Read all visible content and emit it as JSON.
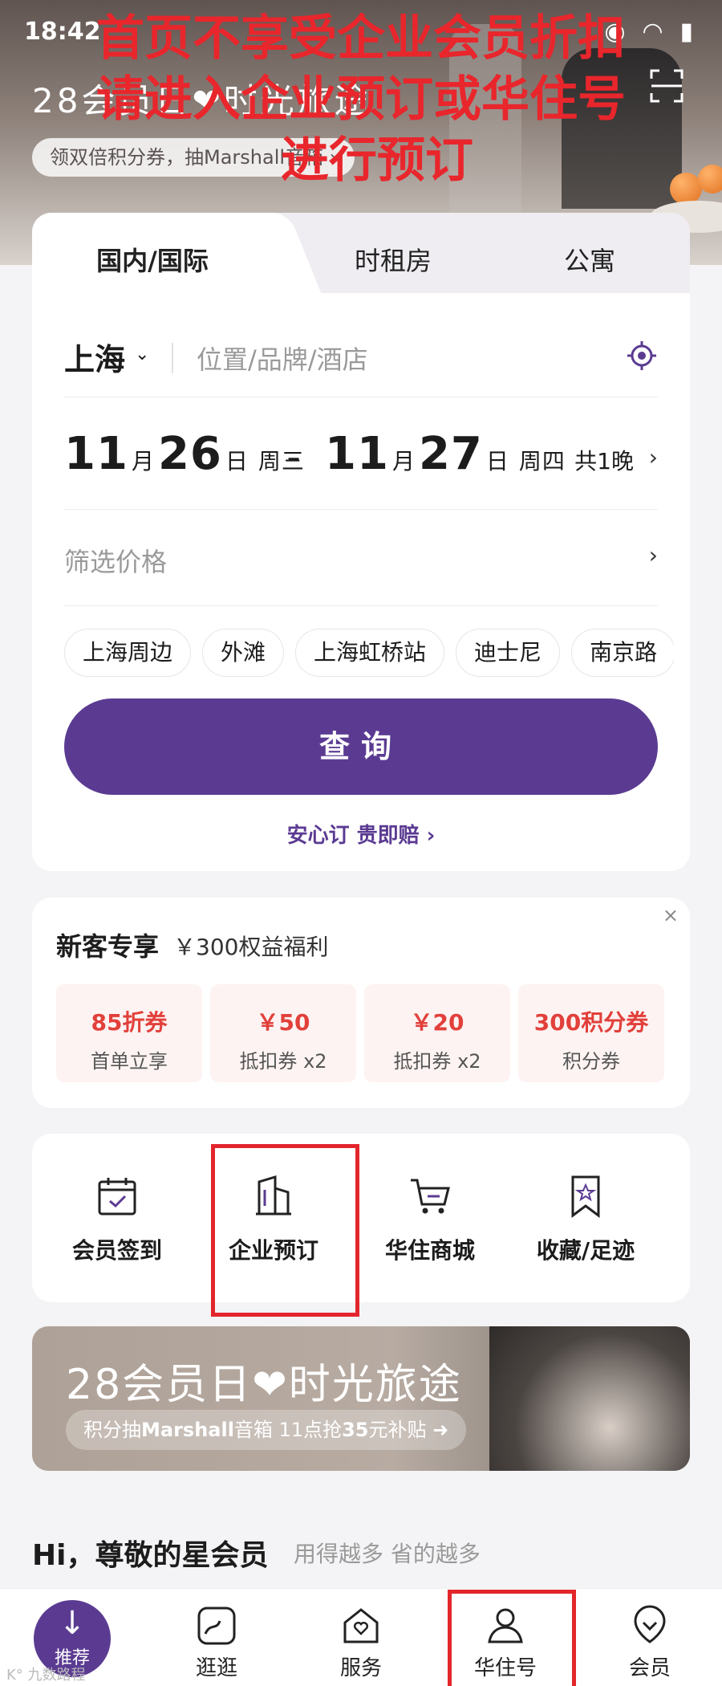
{
  "status": {
    "time": "18:42",
    "icons": "◉ ◠ ▮"
  },
  "hero": {
    "title": "28会员日❤时光旅途",
    "pill": "领双倍积分券，抽Marshall音箱 ›"
  },
  "annotation": {
    "line1": "首页不享受企业会员折扣",
    "line2": "请进入企业预订或华住号",
    "line3": "进行预订"
  },
  "booking": {
    "tabs": [
      "国内/国际",
      "时租房",
      "公寓"
    ],
    "city": "上海",
    "search_placeholder": "位置/品牌/酒店",
    "checkin": {
      "month": "11",
      "day": "26",
      "weekday": "周三"
    },
    "checkout": {
      "month": "11",
      "day": "27",
      "weekday": "周四"
    },
    "month_unit": "月",
    "day_unit": "日",
    "nights": "共1晚",
    "price_placeholder": "筛选价格",
    "chips": [
      "上海周边",
      "外滩",
      "上海虹桥站",
      "迪士尼",
      "南京路"
    ],
    "query_label": "查询",
    "assurance": "安心订 贵即赔 ›"
  },
  "new_customer": {
    "title": "新客专享",
    "subtitle": "￥300权益福利",
    "coupons": [
      {
        "value": "85折券",
        "desc": "首单立享"
      },
      {
        "value": "￥50",
        "desc": "抵扣券 x2"
      },
      {
        "value": "￥20",
        "desc": "抵扣券 x2"
      },
      {
        "value": "300积分券",
        "desc": "积分券"
      }
    ]
  },
  "quick_actions": [
    {
      "label": "会员签到",
      "icon": "calendar-check-icon"
    },
    {
      "label": "企业预订",
      "icon": "building-icon"
    },
    {
      "label": "华住商城",
      "icon": "cart-icon"
    },
    {
      "label": "收藏/足迹",
      "icon": "bookmark-star-icon"
    }
  ],
  "banner": {
    "title": "28会员日❤时光旅途",
    "sub_prefix": "积分抽",
    "sub_brand": "Marshall",
    "sub_mid": "音箱  11点抢",
    "sub_num": "35",
    "sub_suffix": "元补贴"
  },
  "greeting": {
    "title": "Hi，尊敬的星会员",
    "sub": "用得越多 省的越多"
  },
  "tabbar": {
    "items": [
      "推荐",
      "逛逛",
      "服务",
      "华住号",
      "会员"
    ]
  },
  "watermark": "K° 九数路程",
  "colors": {
    "brand_purple": "#5b3b92",
    "highlight_red": "#e2262c",
    "coupon_red": "#e2403b"
  }
}
